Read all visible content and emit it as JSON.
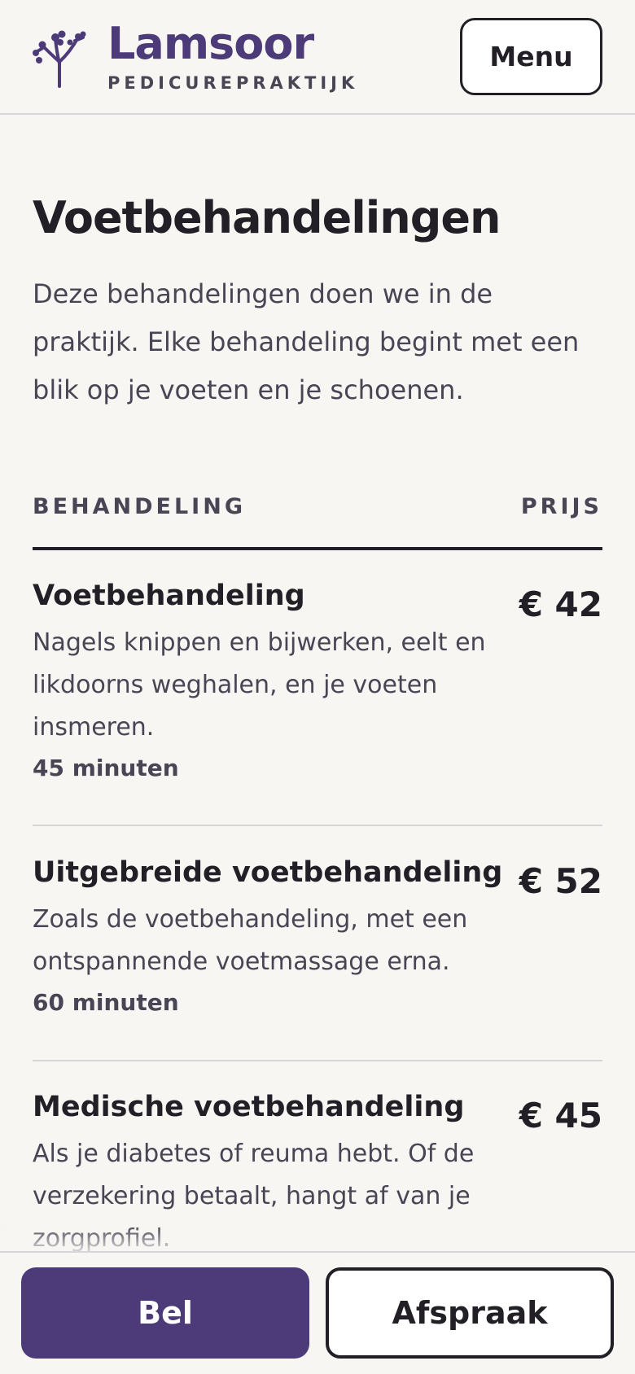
{
  "header": {
    "brand_name": "Lamsoor",
    "brand_subtitle": "PEDICUREPRAKTIJK",
    "logo_icon": "sea-lavender-sprig-icon",
    "menu_label": "Menu",
    "brand_color": "#4c3b78"
  },
  "main": {
    "title": "Voetbehandelingen",
    "intro": "Deze behandelingen doen we in de praktijk. Elke behandeling begint met een blik op je voeten en je schoenen.",
    "table": {
      "col_treatment": "BEHANDELING",
      "col_price": "PRIJS",
      "rows": [
        {
          "name": "Voetbehandeling",
          "description": "Nagels knippen en bijwerken, eelt en likdoorns weghalen, en je voeten insmeren.",
          "duration": "45 minuten",
          "price": "€ 42"
        },
        {
          "name": "Uitgebreide voetbehandeling",
          "description": "Zoals de voetbehandeling, met een ontspannende voetmassage erna.",
          "duration": "60 minuten",
          "price": "€ 52"
        },
        {
          "name": "Medische voetbehandeling",
          "description": "Als je diabetes of reuma hebt. Of de verzekering betaalt, hangt af van je zorgprofiel.",
          "price": "€ 45"
        }
      ]
    }
  },
  "bottom_bar": {
    "call_label": "Bel",
    "appointment_label": "Afspraak"
  }
}
